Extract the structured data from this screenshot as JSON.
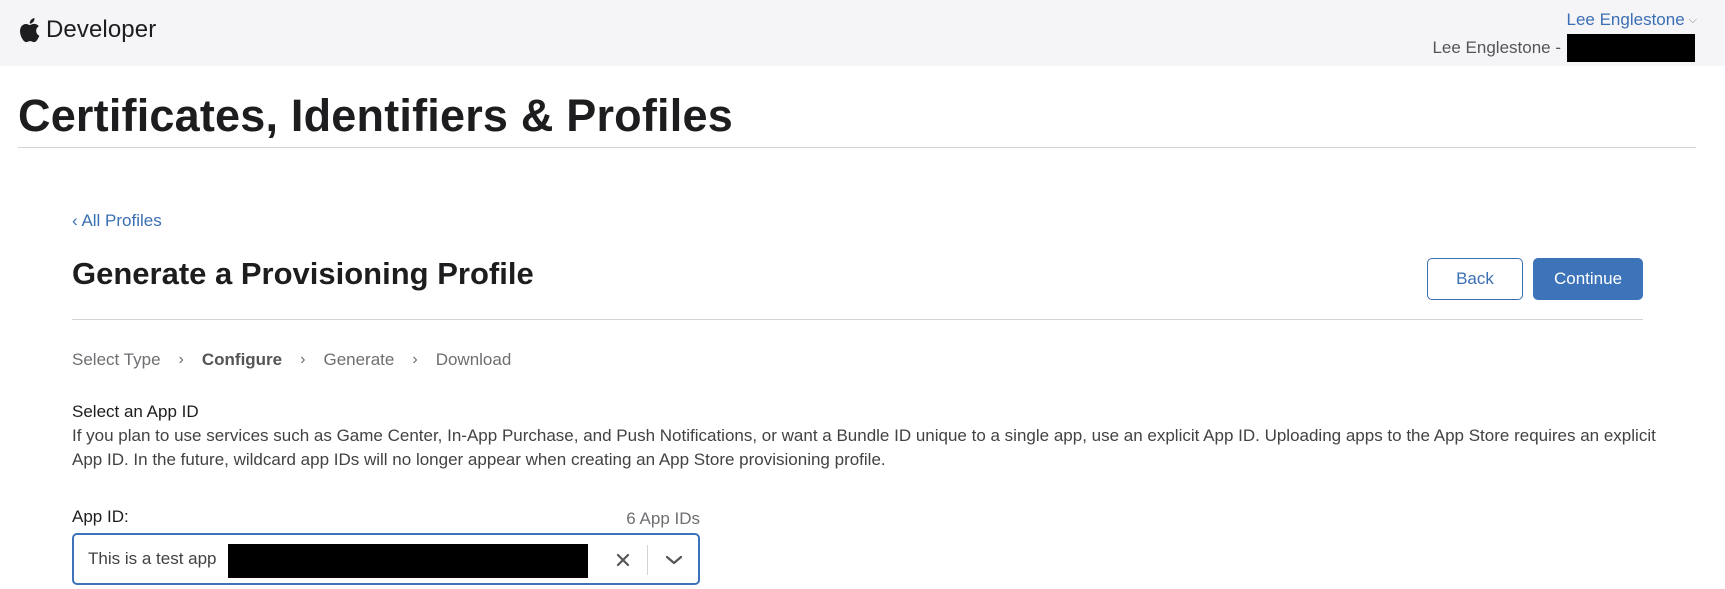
{
  "header": {
    "brand_label": "Developer",
    "account_name": "Lee Englestone",
    "team_prefix": "Lee Englestone -"
  },
  "page": {
    "title": "Certificates, Identifiers & Profiles",
    "back_link": "‹ All Profiles",
    "heading": "Generate a Provisioning Profile",
    "back_button": "Back",
    "continue_button": "Continue"
  },
  "steps": [
    {
      "label": "Select Type",
      "active": false
    },
    {
      "label": "Configure",
      "active": true
    },
    {
      "label": "Generate",
      "active": false
    },
    {
      "label": "Download",
      "active": false
    }
  ],
  "step_separator": "›",
  "section": {
    "label": "Select an App ID",
    "description": "If you plan to use services such as Game Center, In-App Purchase, and Push Notifications, or want a Bundle ID unique to a single app, use an explicit App ID. Uploading apps to the App Store requires an explicit App ID. In the future, wildcard app IDs will no longer appear when creating an App Store provisioning profile."
  },
  "app_id_field": {
    "label": "App ID:",
    "count": "6 App IDs",
    "value": "This is a test app"
  },
  "colors": {
    "accent": "#3d73b9",
    "link": "#3a6fb3",
    "topbar_bg": "#f5f5f7",
    "divider": "#d2d2d7"
  },
  "icons": [
    "apple-logo-icon",
    "chevron-down-icon",
    "clear-icon",
    "chevron-right-icon"
  ]
}
